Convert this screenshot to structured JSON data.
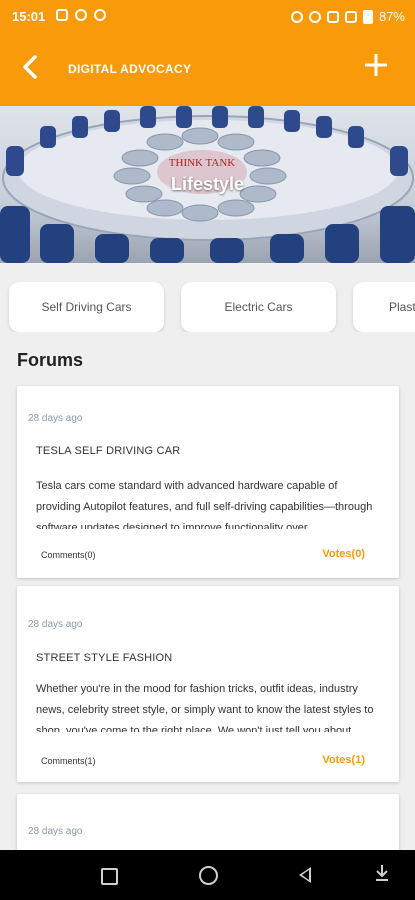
{
  "status": {
    "time": "15:01",
    "battery": "87%"
  },
  "appbar": {
    "back_icon": "←",
    "title": "DIGITAL ADVOCACY",
    "add_icon": "+"
  },
  "banner": {
    "label": "Lifestyle",
    "think_tank": "THINK TANK"
  },
  "categories": [
    {
      "label": "Self Driving Cars"
    },
    {
      "label": "Electric Cars"
    },
    {
      "label": "Plast"
    }
  ],
  "section": {
    "title": "Forums"
  },
  "forums": [
    {
      "date": "28 days ago",
      "title": "TESLA SELF DRIVING CAR",
      "description": "Tesla cars come standard with advanced hardware capable of providing Autopilot features, and full self-driving capabilities—through software updates designed to improve functionality over",
      "comments": "Comments(0)",
      "votes": "Votes(0)"
    },
    {
      "date": "28 days ago",
      "title": "STREET STYLE FASHION",
      "description": "Whether you're in the mood for fashion tricks, outfit ideas, industry news, celebrity street style, or simply want to know the latest styles to shop, you've come to the right place. We won't just tell you about",
      "comments": "Comments(1)",
      "votes": "Votes(1)"
    },
    {
      "date": "28 days ago"
    }
  ],
  "colors": {
    "accent": "#f89a0a",
    "background": "#efefef"
  }
}
